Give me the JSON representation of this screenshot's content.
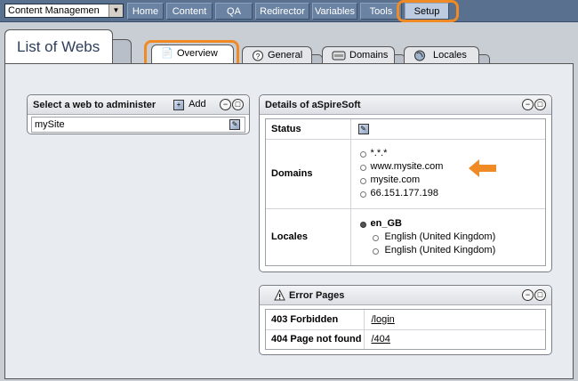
{
  "nav": {
    "select_value": "Content Managemen",
    "items": [
      {
        "label": "Home"
      },
      {
        "label": "Content"
      },
      {
        "label": "QA"
      },
      {
        "label": "Redirector"
      },
      {
        "label": "Variables"
      },
      {
        "label": "Tools"
      },
      {
        "label": "Setup",
        "active": true
      }
    ]
  },
  "page": {
    "title": "List of Webs"
  },
  "tabs": [
    {
      "label": "Overview",
      "icon": "document-icon",
      "active": true
    },
    {
      "label": "General",
      "icon": "settings-icon"
    },
    {
      "label": "Domains",
      "icon": "server-icon"
    },
    {
      "label": "Locales",
      "icon": "globe-icon"
    }
  ],
  "webs_panel": {
    "title": "Select a web to administer",
    "add_label": "Add",
    "items": [
      "mySite"
    ]
  },
  "details_panel": {
    "title": "Details of aSpireSoft",
    "status_label": "Status",
    "domains_label": "Domains",
    "domains": [
      "*.*.*",
      "www.mysite.com",
      "mysite.com",
      "66.151.177.198"
    ],
    "locales_label": "Locales",
    "locale_group": "en_GB",
    "locale_items": [
      "English (United Kingdom)",
      "English (United Kingdom)"
    ]
  },
  "errors_panel": {
    "title": "Error Pages",
    "rows": [
      {
        "label": "403 Forbidden",
        "value": "/login"
      },
      {
        "label": "404 Page not found",
        "value": "/404"
      }
    ]
  },
  "colors": {
    "highlight": "#f08a24",
    "nav_bg": "#59708e"
  }
}
